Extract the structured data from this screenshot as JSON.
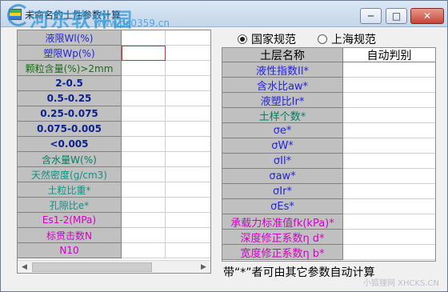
{
  "window": {
    "title": "未命名的土性参数计算",
    "minimize_label": "─",
    "maximize_label": "□",
    "close_label": "✕"
  },
  "watermark": {
    "brand": "河东软件园",
    "url": "www.pc0359.cn",
    "corner": "小狐狸网 XHCKS.CN"
  },
  "left_table": {
    "rows": [
      {
        "label": "液限Wl(%)",
        "color": "blue"
      },
      {
        "label": "塑限Wp(%)",
        "color": "blue"
      },
      {
        "label": "颗粒含量(%)>2mm",
        "color": "dgreen"
      },
      {
        "label": "2-0.5",
        "color": "navy"
      },
      {
        "label": "0.5-0.25",
        "color": "navy"
      },
      {
        "label": "0.25-0.075",
        "color": "navy"
      },
      {
        "label": "0.075-0.005",
        "color": "navy"
      },
      {
        "label": "<0.005",
        "color": "navy"
      },
      {
        "label": "含水量W(%)",
        "color": "green"
      },
      {
        "label": "天然密度(g/cm3)",
        "color": "teal"
      },
      {
        "label": "土粒比重*",
        "color": "teal"
      },
      {
        "label": "孔隙比e*",
        "color": "teal"
      },
      {
        "label": "Es1-2(MPa)",
        "color": "mag"
      },
      {
        "label": "标贯击数N",
        "color": "mag"
      },
      {
        "label": "N10",
        "color": "mag"
      }
    ]
  },
  "radios": {
    "national": "国家规范",
    "shanghai": "上海规范",
    "selected": "national"
  },
  "right_table": {
    "header_name": "土层名称",
    "header_value": "自动判别",
    "rows": [
      {
        "label": "液性指数Il*",
        "color": "blue"
      },
      {
        "label": "含水比aw*",
        "color": "blue"
      },
      {
        "label": "液塑比Ir*",
        "color": "blue"
      },
      {
        "label": "土样个数*",
        "color": "green"
      },
      {
        "label": "σe*",
        "color": "blue"
      },
      {
        "label": "σW*",
        "color": "blue"
      },
      {
        "label": "σIl*",
        "color": "blue"
      },
      {
        "label": "σaw*",
        "color": "blue"
      },
      {
        "label": "σIr*",
        "color": "blue"
      },
      {
        "label": "σEs*",
        "color": "blue"
      },
      {
        "label": "承载力标准值fk(kPa)*",
        "color": "mag"
      },
      {
        "label": "深度修正系数η d*",
        "color": "mag"
      },
      {
        "label": "宽度修正系数η b*",
        "color": "mag"
      }
    ]
  },
  "footer": {
    "note": "带“*”者可由其它参数自动计算"
  }
}
